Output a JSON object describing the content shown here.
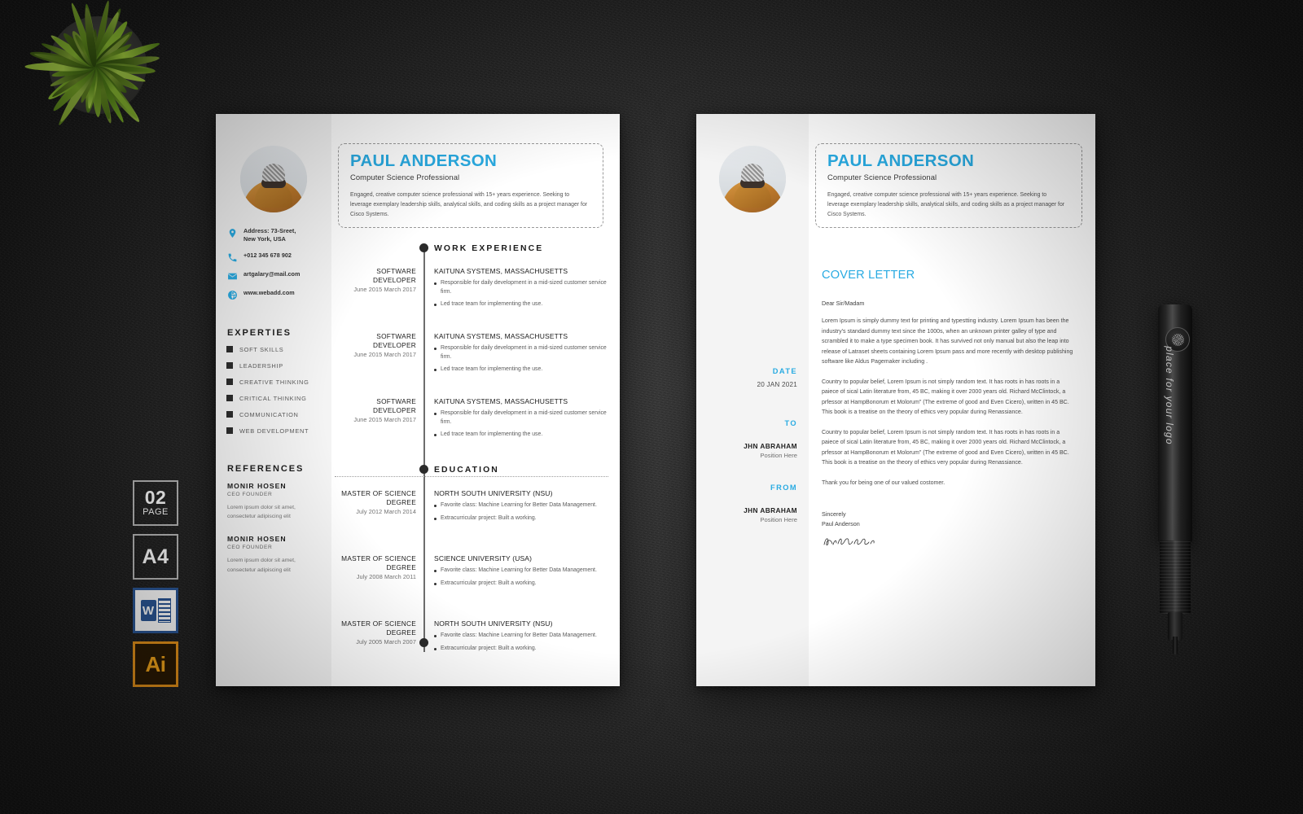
{
  "mockup": {
    "background_color": "#2a2a2a",
    "accent_color": "#29abe2",
    "plant_label": "decorative-plant"
  },
  "badges": [
    {
      "name": "page-count-badge",
      "big": "02",
      "small": "PAGE"
    },
    {
      "name": "paper-size-badge",
      "big": "A4",
      "small": ""
    },
    {
      "name": "word-format-badge",
      "big": "W",
      "small": ""
    },
    {
      "name": "illustrator-format-badge",
      "big": "Ai",
      "small": ""
    }
  ],
  "pen": {
    "logo_text": "place for your logo"
  },
  "profile": {
    "name": "PAUL ANDERSON",
    "role": "Computer Science Professional",
    "summary": "Engaged, creative computer science professional with 15+ years experience. Seeking to leverage exemplary leadership skills, analytical skills, and coding skills as a project manager for Cisco Systems."
  },
  "contacts": [
    {
      "icon": "location-icon",
      "text": "Address: 73-Sreet,\nNew York, USA"
    },
    {
      "icon": "phone-icon",
      "text": "+012 345 678 902"
    },
    {
      "icon": "mail-icon",
      "text": "artgalary@mail.com"
    },
    {
      "icon": "globe-icon",
      "text": "www.webadd.com"
    }
  ],
  "experties": {
    "title": "EXPERTIES",
    "items": [
      "SOFT SKILLS",
      "LEADERSHIP",
      "CREATIVE THINKING",
      "CRITICAL THINKING",
      "COMMUNICATION",
      "WEB DEVELOPMENT"
    ]
  },
  "references": {
    "title": "REFERENCES",
    "items": [
      {
        "name": "MONIR HOSEN",
        "role": "CEO FOUNDER",
        "desc": "Lorem ipsum dolor sit amet, consectetur adipiscing elit"
      },
      {
        "name": "MONIR HOSEN",
        "role": "CEO FOUNDER",
        "desc": "Lorem ipsum dolor sit amet, consectetur adipiscing elit"
      }
    ]
  },
  "work_experience": {
    "title": "WORK EXPERIENCE",
    "entries": [
      {
        "title": "SOFTWARE DEVELOPER",
        "date": "June 2015 March 2017",
        "org": "KAITUNA SYSTEMS, MASSACHUSETTS",
        "bullets": [
          "Responsible for daily development in a mid-sized customer service firm.",
          "Led trace team for implementing the use."
        ]
      },
      {
        "title": "SOFTWARE DEVELOPER",
        "date": "June 2015 March 2017",
        "org": "KAITUNA SYSTEMS, MASSACHUSETTS",
        "bullets": [
          "Responsible for daily development in a mid-sized customer service firm.",
          "Led trace team for implementing the use."
        ]
      },
      {
        "title": "SOFTWARE DEVELOPER",
        "date": "June 2015 March 2017",
        "org": "KAITUNA SYSTEMS, MASSACHUSETTS",
        "bullets": [
          "Responsible for daily development in a mid-sized customer service firm.",
          "Led trace team for implementing the use."
        ]
      }
    ]
  },
  "education": {
    "title": "EDUCATION",
    "entries": [
      {
        "title": "MASTER OF SCIENCE DEGREE",
        "date": "July 2012 March 2014",
        "org": "NORTH SOUTH UNIVERSITY (NSU)",
        "bullets": [
          "Favorite class: Machine Learning for Better Data Management.",
          "Extracurricular project: Built a working."
        ]
      },
      {
        "title": "MASTER OF SCIENCE DEGREE",
        "date": "July 2008 March 2011",
        "org": "SCIENCE UNIVERSITY (USA)",
        "bullets": [
          "Favorite class: Machine Learning for Better Data Management.",
          "Extracurricular project: Built a working."
        ]
      },
      {
        "title": "MASTER OF SCIENCE DEGREE",
        "date": "July 2005 March 2007",
        "org": "NORTH SOUTH UNIVERSITY (NSU)",
        "bullets": [
          "Favorite class: Machine Learning for Better Data Management.",
          "Extracurricular project: Built a working."
        ]
      }
    ]
  },
  "cover_letter": {
    "date_label": "DATE",
    "date_value": "20 JAN 2021",
    "to_label": "TO",
    "to_name": "JHN ABRAHAM",
    "to_position": "Position Here",
    "from_label": "FROM",
    "from_name": "JHN ABRAHAM",
    "from_position": "Position Here",
    "title": "COVER LETTER",
    "greeting": "Dear Sir/Madam",
    "paragraphs": [
      "Lorem Ipsum is simply dummy text for printing and typestting industry. Lorem Ipsum has been the industry's standard dummy text since the 1000s, when an unknown printer galley of type and scrambled it to make a type specimen book. It has survived not only manual but also the leap into release of Latraset sheets containing Lorem Ipsum pass and more recently with desktop publishing software like Aldus Pagemaker including .",
      "Country to popular belief, Lorem Ipsum is not simply random text. It has roots in has roots in a paiece of sical  Latin literature from, 45 BC, making it over 2000 years old. Richard McClintock, a prfessor at HampBonorum et Molorum\" (The extreme of good and Even Cicero), written in 45 BC. This book is a treatise on the theory of ethics very popular during  Renassiance.",
      "Country to popular belief, Lorem Ipsum is not simply random text. It has roots in  has roots in a paiece of sical  Latin literature from, 45 BC, making it over 2000 years old. Richard McClintock, a prfessor at HampBonorum et Molorum\" (The extreme of good and Even Cicero), written in 45 BC. This book is a treatise on the theory of ethics very popular during  Renassiance.",
      "Thank you for being one of our valued costomer."
    ],
    "closing_label": "Sincerely",
    "closing_name": "Paul Anderson"
  }
}
